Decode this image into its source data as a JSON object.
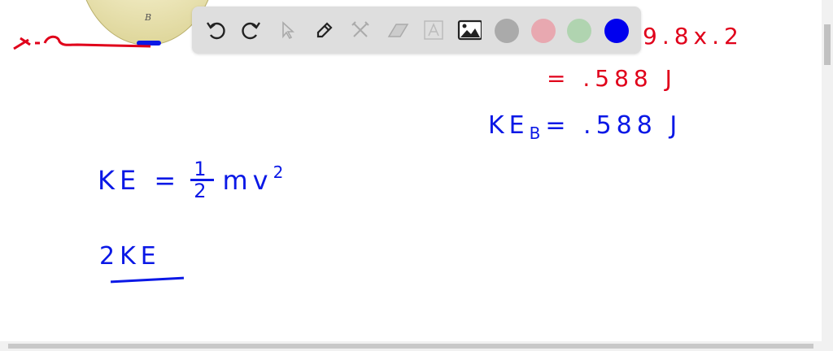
{
  "toolbar": {
    "tools": [
      "undo-icon",
      "redo-icon",
      "select-icon",
      "pen-icon",
      "tools-icon",
      "eraser-icon",
      "text-icon",
      "image-icon"
    ],
    "colors": [
      "#aaaaaa",
      "#e8a8b0",
      "#b0d4b0",
      "#0000ee"
    ],
    "active_color": "#0000ee"
  },
  "figure": {
    "label_b": "B"
  },
  "notes": {
    "red_line1": "9.8x.2",
    "red_line2": "= .588 J",
    "ke_b_prefix": "KE",
    "ke_b_sub": "B",
    "ke_b_value": "= .588 J",
    "ke_formula_lhs": "KE =",
    "ke_formula_num": "1",
    "ke_formula_den": "2",
    "ke_formula_rhs": "mv",
    "ke_formula_exp": "2",
    "two_ke": "2KE"
  }
}
